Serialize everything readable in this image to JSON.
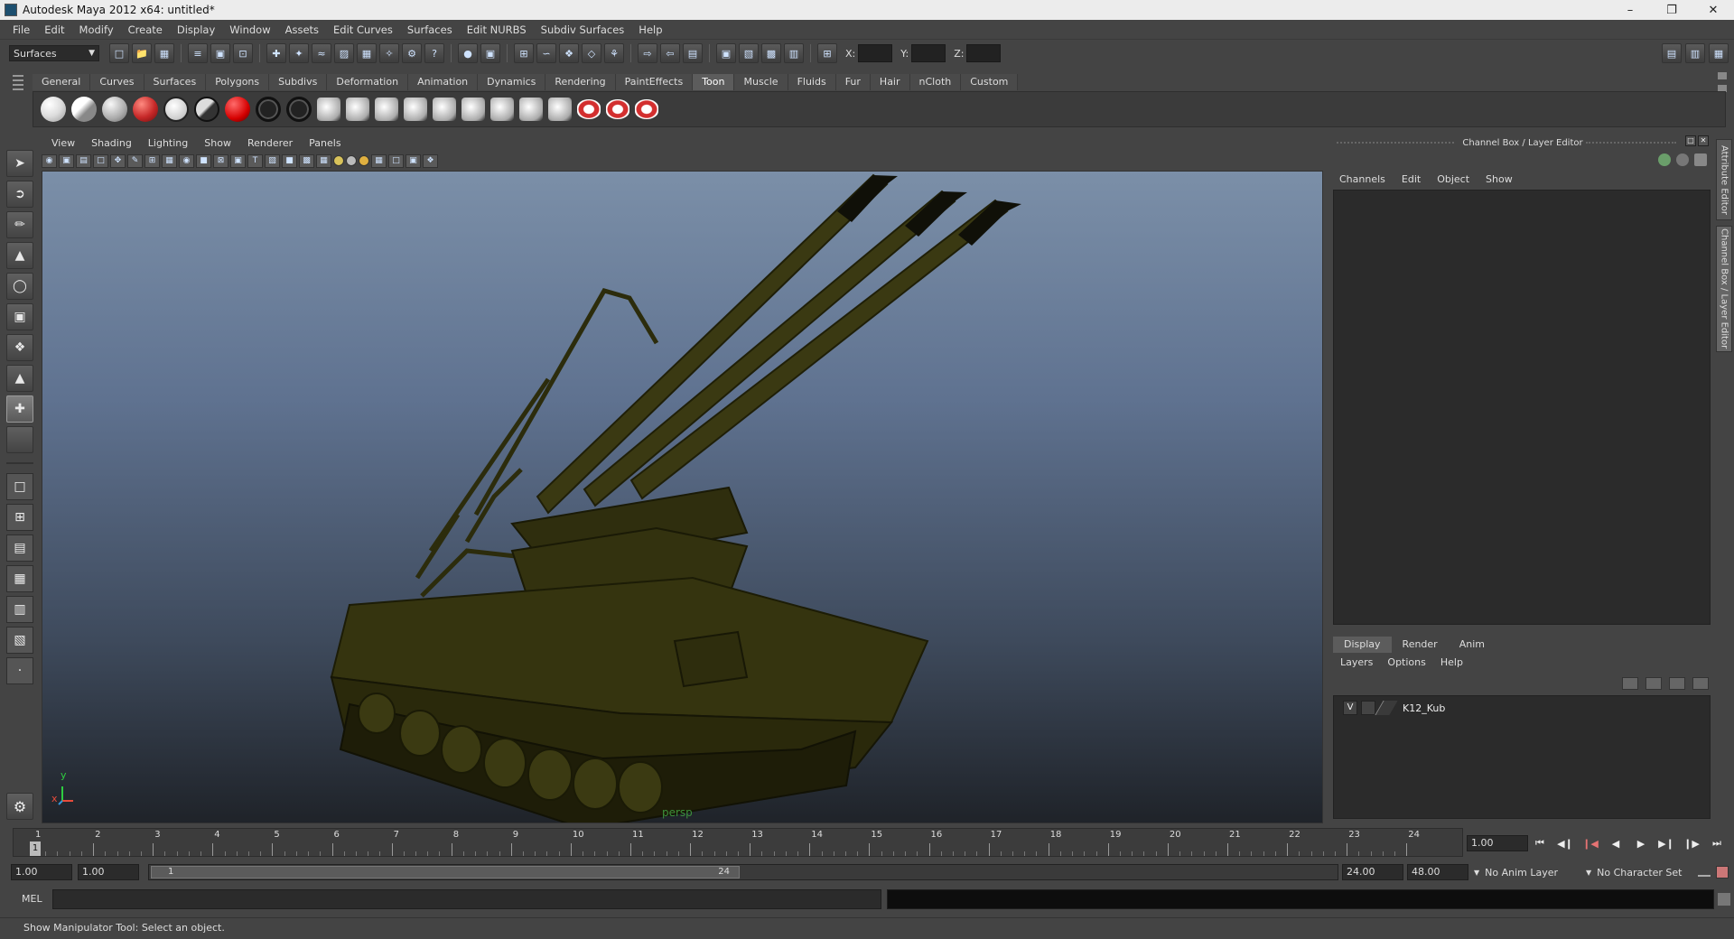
{
  "window": {
    "title": "Autodesk Maya 2012 x64: untitled*"
  },
  "menubar": [
    "File",
    "Edit",
    "Modify",
    "Create",
    "Display",
    "Window",
    "Assets",
    "Edit Curves",
    "Surfaces",
    "Edit NURBS",
    "Subdiv Surfaces",
    "Help"
  ],
  "statusline": {
    "mode": "Surfaces",
    "x_label": "X:",
    "y_label": "Y:",
    "z_label": "Z:"
  },
  "shelf": {
    "tabs": [
      "General",
      "Curves",
      "Surfaces",
      "Polygons",
      "Subdivs",
      "Deformation",
      "Animation",
      "Dynamics",
      "Rendering",
      "PaintEffects",
      "Toon",
      "Muscle",
      "Fluids",
      "Fur",
      "Hair",
      "nCloth",
      "Custom"
    ],
    "active_tab": "Toon"
  },
  "panel": {
    "menu": [
      "View",
      "Shading",
      "Lighting",
      "Show",
      "Renderer",
      "Panels"
    ],
    "camera_label": "persp",
    "axis_x": "x",
    "axis_y": "y"
  },
  "channel_box": {
    "header": "Channel Box / Layer Editor",
    "menu": [
      "Channels",
      "Edit",
      "Object",
      "Show"
    ],
    "side_tab_attribute": "Attribute Editor",
    "side_tab_channel": "Channel Box / Layer Editor"
  },
  "layer_editor": {
    "tabs": [
      "Display",
      "Render",
      "Anim"
    ],
    "active_tab": "Display",
    "menu": [
      "Layers",
      "Options",
      "Help"
    ],
    "layers": [
      {
        "visible": "V",
        "name": "K12_Kub"
      }
    ]
  },
  "time_slider": {
    "ticks": [
      "1",
      "2",
      "3",
      "4",
      "5",
      "6",
      "7",
      "8",
      "9",
      "10",
      "11",
      "12",
      "13",
      "14",
      "15",
      "16",
      "17",
      "18",
      "19",
      "20",
      "21",
      "22",
      "23",
      "24"
    ],
    "current_frame_marker": "1",
    "current_time": "1.00"
  },
  "range_slider": {
    "start_time": "1.00",
    "playback_start": "1.00",
    "range_start": "1",
    "range_end": "24",
    "playback_end": "24.00",
    "end_time": "48.00",
    "anim_layer": "No Anim Layer",
    "character_set": "No Character Set"
  },
  "command_line": {
    "label": "MEL"
  },
  "help_line": {
    "text": "Show Manipulator Tool: Select an object."
  },
  "colors": {
    "tank_olive": "#3b3a12",
    "viewport_top": "#7b8fa8",
    "viewport_bottom": "#1f2329"
  }
}
